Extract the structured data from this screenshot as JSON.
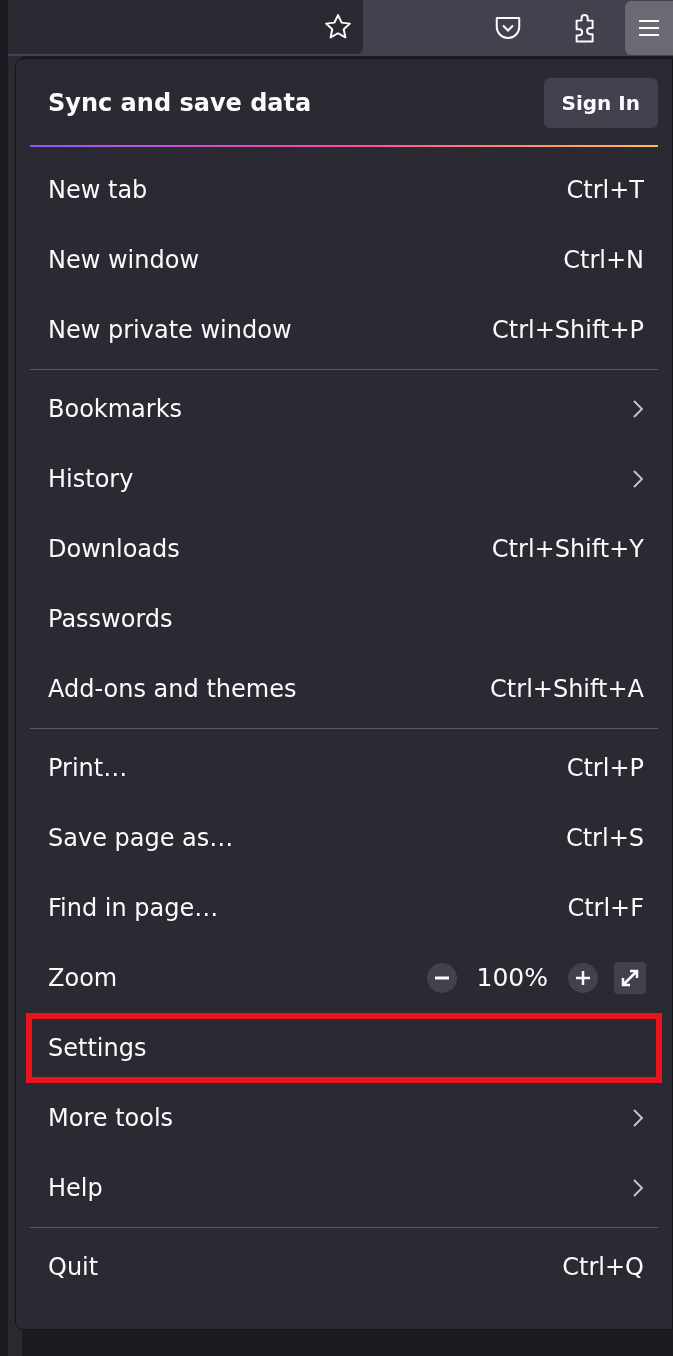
{
  "header": {
    "title": "Sync and save data",
    "button": "Sign In"
  },
  "sections": [
    [
      {
        "kind": "item",
        "label": "New tab",
        "shortcut": "Ctrl+T",
        "submenu": false,
        "highlighted": false
      },
      {
        "kind": "item",
        "label": "New window",
        "shortcut": "Ctrl+N",
        "submenu": false,
        "highlighted": false
      },
      {
        "kind": "item",
        "label": "New private window",
        "shortcut": "Ctrl+Shift+P",
        "submenu": false,
        "highlighted": false
      }
    ],
    [
      {
        "kind": "item",
        "label": "Bookmarks",
        "submenu": true,
        "highlighted": false
      },
      {
        "kind": "item",
        "label": "History",
        "submenu": true,
        "highlighted": false
      },
      {
        "kind": "item",
        "label": "Downloads",
        "shortcut": "Ctrl+Shift+Y",
        "submenu": false,
        "highlighted": false
      },
      {
        "kind": "item",
        "label": "Passwords",
        "submenu": false,
        "highlighted": false
      },
      {
        "kind": "item",
        "label": "Add-ons and themes",
        "shortcut": "Ctrl+Shift+A",
        "submenu": false,
        "highlighted": false
      }
    ],
    [
      {
        "kind": "item",
        "label": "Print…",
        "shortcut": "Ctrl+P",
        "submenu": false,
        "highlighted": false
      },
      {
        "kind": "item",
        "label": "Save page as…",
        "shortcut": "Ctrl+S",
        "submenu": false,
        "highlighted": false
      },
      {
        "kind": "item",
        "label": "Find in page…",
        "shortcut": "Ctrl+F",
        "submenu": false,
        "highlighted": false
      },
      {
        "kind": "zoom",
        "label": "Zoom",
        "value": "100%"
      },
      {
        "kind": "item",
        "label": "Settings",
        "submenu": false,
        "highlighted": true
      },
      {
        "kind": "item",
        "label": "More tools",
        "submenu": true,
        "highlighted": false
      },
      {
        "kind": "item",
        "label": "Help",
        "submenu": true,
        "highlighted": false
      }
    ],
    [
      {
        "kind": "item",
        "label": "Quit",
        "shortcut": "Ctrl+Q",
        "submenu": false,
        "highlighted": false
      }
    ]
  ]
}
